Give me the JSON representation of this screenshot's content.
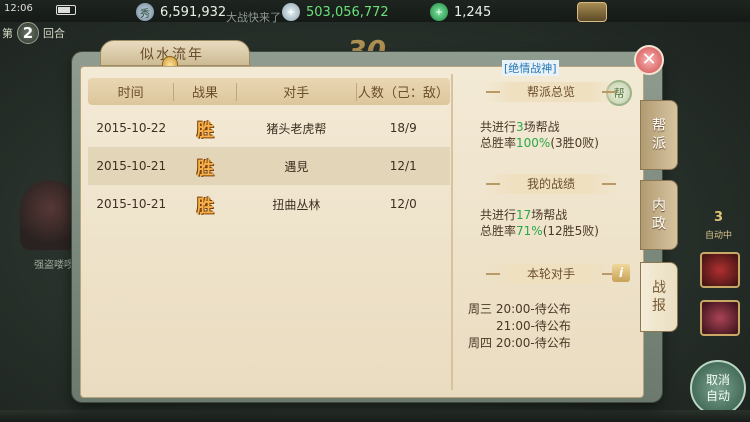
{
  "status": {
    "time": "12:06"
  },
  "resources": {
    "gold": "6,591,932",
    "gold_icon": "秀",
    "silver": "503,056,772",
    "jade": "1,245"
  },
  "background": {
    "round_prefix": "第",
    "round_num": "2",
    "round_suffix": "回合",
    "big_number": "30",
    "left_char_label": "强盗喽啰",
    "right_count": "3",
    "right_auto": "自动中",
    "cancel_auto": "取消\n自动",
    "obscured_text": "大战快来了"
  },
  "panel": {
    "title": "似水流年",
    "war_link": "[绝情战神]",
    "close_label": "✕",
    "headers": {
      "time": "时间",
      "result": "战果",
      "opponent": "对手",
      "count": "人数（己：敌）"
    },
    "rows": [
      {
        "time": "2015-10-22",
        "result": "胜",
        "opponent": "猪头老虎帮",
        "count": "18/9"
      },
      {
        "time": "2015-10-21",
        "result": "胜",
        "opponent": "遇見",
        "count": "12/1"
      },
      {
        "time": "2015-10-21",
        "result": "胜",
        "opponent": "扭曲丛林",
        "count": "12/0"
      }
    ]
  },
  "info": {
    "guild_title": "帮派总览",
    "guild_line1_pre": "共进行",
    "guild_line1_num": "3",
    "guild_line1_post": "场帮战",
    "guild_line2_pre": "总胜率",
    "guild_line2_pct": "100%",
    "guild_line2_post": "(3胜0败)",
    "mine_title": "我的战绩",
    "mine_line1_pre": "共进行",
    "mine_line1_num": "17",
    "mine_line1_post": "场帮战",
    "mine_line2_pre": "总胜率",
    "mine_line2_pct": "71%",
    "mine_line2_post": "(12胜5败)",
    "round_title": "本轮对手",
    "schedule": [
      "周三 20:00-待公布",
      "21:00-待公布",
      "周四 20:00-待公布"
    ],
    "flag_icon_text": "帮"
  },
  "tabs": [
    {
      "label1": "帮",
      "label2": "派"
    },
    {
      "label1": "内",
      "label2": "政"
    },
    {
      "label1": "战",
      "label2": "报"
    }
  ]
}
